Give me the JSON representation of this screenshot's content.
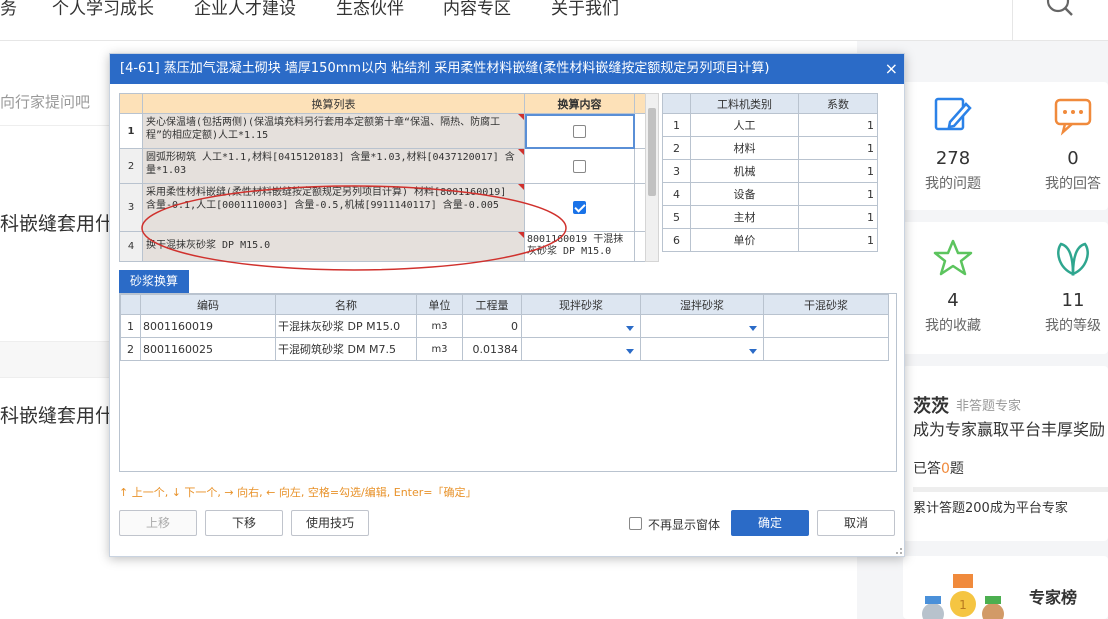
{
  "nav": {
    "items": [
      "务",
      "个人学习成长",
      "企业人才建设",
      "生态伙伴",
      "内容专区",
      "关于我们"
    ]
  },
  "left": {
    "line1": "向行家提问吧",
    "line2": "科嵌缝套用什么",
    "line3": "科嵌缝套用什么"
  },
  "stats": [
    {
      "num": "278",
      "label": "我的问题"
    },
    {
      "num": "0",
      "label": "我的回答"
    },
    {
      "num": "4",
      "label": "我的收藏"
    },
    {
      "num": "11",
      "label": "我的等级"
    }
  ],
  "expert": {
    "name": "茨茨",
    "tag": "非答题专家",
    "slogan": "成为专家赢取平台丰厚奖励",
    "answered_prefix": "已答",
    "answered_count": "0",
    "answered_suffix": "题",
    "accum": "累计答题200成为平台专家",
    "rank_title": "专家榜"
  },
  "dialog": {
    "title": "[4-61] 蒸压加气混凝土砌块 墙厚150mm以内 粘结剂 采用柔性材料嵌缝(柔性材料嵌缝按定额规定另列项目计算)",
    "close": "×",
    "conv": {
      "h_list": "换算列表",
      "h_content": "换算内容",
      "rows": [
        {
          "no": "1",
          "text": "夹心保温墙(包括两侧)(保温填充料另行套用本定额第十章“保温、隔热、防腐工程”的相应定额)人工*1.15",
          "content": "",
          "checked": false
        },
        {
          "no": "2",
          "text": "圆弧形砌筑 人工*1.1,材料[0415120183] 含量*1.03,材料[0437120017] 含量*1.03",
          "content": "",
          "checked": false
        },
        {
          "no": "3",
          "text": "采用柔性材料嵌缝(柔性材料嵌缝按定额规定另列项目计算) 材料[8001160019] 含量-0.1,人工[0001110003] 含量-0.5,机械[9911140117] 含量-0.005",
          "content": "",
          "checked": true
        },
        {
          "no": "4",
          "text": "换干混抹灰砂浆 DP M15.0",
          "content": "8001160019 干混抹灰砂浆 DP M15.0",
          "checked": null
        }
      ]
    },
    "coef": {
      "h_type": "工料机类别",
      "h_coef": "系数",
      "rows": [
        {
          "no": "1",
          "type": "人工",
          "coef": "1"
        },
        {
          "no": "2",
          "type": "材料",
          "coef": "1"
        },
        {
          "no": "3",
          "type": "机械",
          "coef": "1"
        },
        {
          "no": "4",
          "type": "设备",
          "coef": "1"
        },
        {
          "no": "5",
          "type": "主材",
          "coef": "1"
        },
        {
          "no": "6",
          "type": "单价",
          "coef": "1"
        }
      ]
    },
    "tab": "砂浆换算",
    "mortar": {
      "headers": [
        "编码",
        "名称",
        "单位",
        "工程量",
        "现拌砂浆",
        "湿拌砂浆",
        "干混砂浆"
      ],
      "rows": [
        {
          "no": "1",
          "code": "8001160019",
          "name": "干混抹灰砂浆 DP M15.0",
          "unit": "m3",
          "qty": "0"
        },
        {
          "no": "2",
          "code": "8001160025",
          "name": "干混砌筑砂浆 DM M7.5",
          "unit": "m3",
          "qty": "0.01384"
        }
      ]
    },
    "hint": "↑ 上一个, ↓ 下一个, → 向右, ← 向左, 空格=勾选/编辑, Enter=「确定」",
    "btn_up": "上移",
    "btn_down": "下移",
    "btn_tips": "使用技巧",
    "no_show": "不再显示窗体",
    "ok": "确定",
    "cancel": "取消"
  },
  "colors": {
    "accent": "#2b6bc7",
    "header_orange": "#fde1b8",
    "row_gray": "#e5e0dc",
    "annotation": "#d0312d",
    "hint": "#e8922a"
  }
}
